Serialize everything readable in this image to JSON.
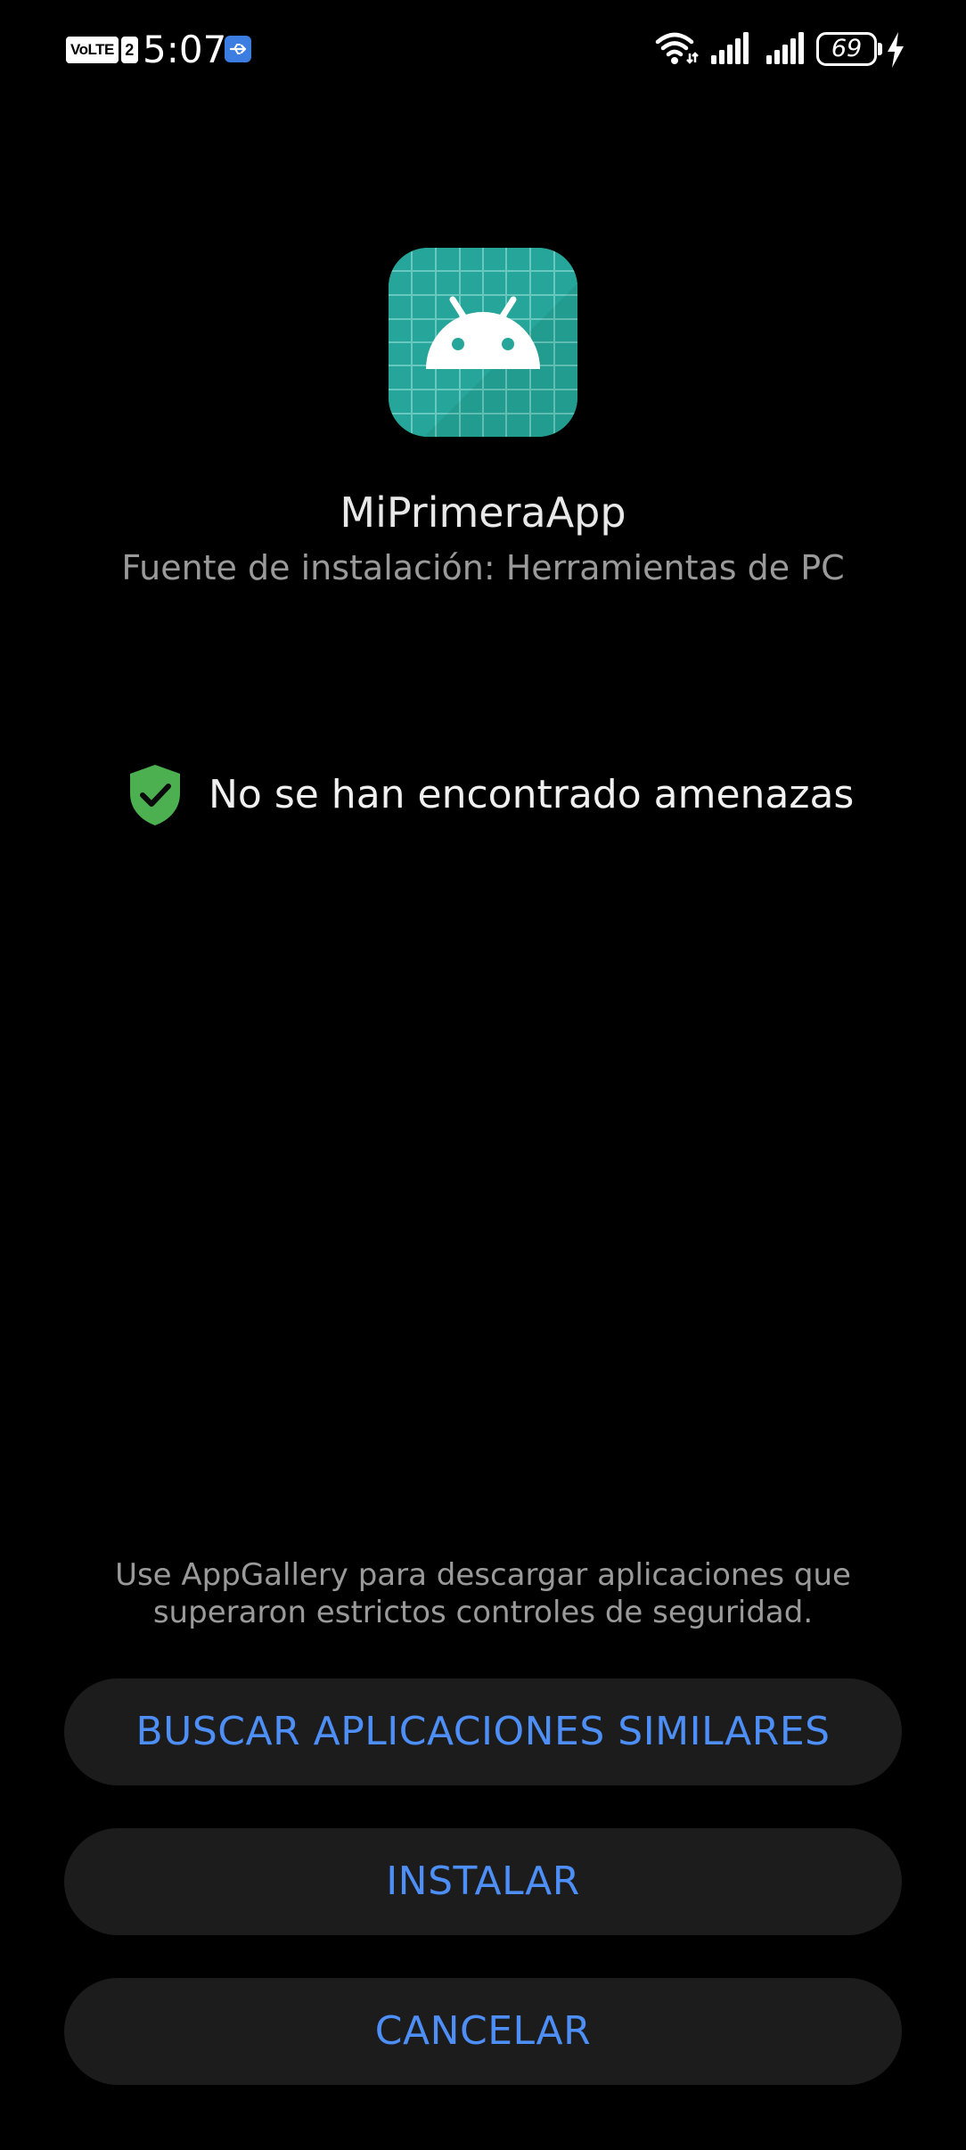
{
  "status_bar": {
    "network_badge": "VoLTE",
    "sim_slot": "2",
    "time": "5:07",
    "battery_level": "69",
    "icons": [
      "usb-debug-icon",
      "wifi-icon",
      "signal-sim1-icon",
      "signal-sim2-icon",
      "battery-icon",
      "charging-bolt-icon"
    ]
  },
  "app": {
    "icon": "android-app-icon",
    "icon_color": "#26a69a",
    "name": "MiPrimeraApp",
    "install_source": "Fuente de instalación: Herramientas de PC"
  },
  "security": {
    "icon": "shield-check-icon",
    "icon_color": "#4caf50",
    "result": "No se han encontrado amenazas"
  },
  "footer": {
    "hint_line1": "Use AppGallery para descargar aplicaciones que",
    "hint_line2": "superaron estrictos controles de seguridad.",
    "buttons": {
      "similar": "BUSCAR APLICACIONES SIMILARES",
      "install": "INSTALAR",
      "cancel": "CANCELAR"
    },
    "accent_color": "#4d8ef7"
  }
}
